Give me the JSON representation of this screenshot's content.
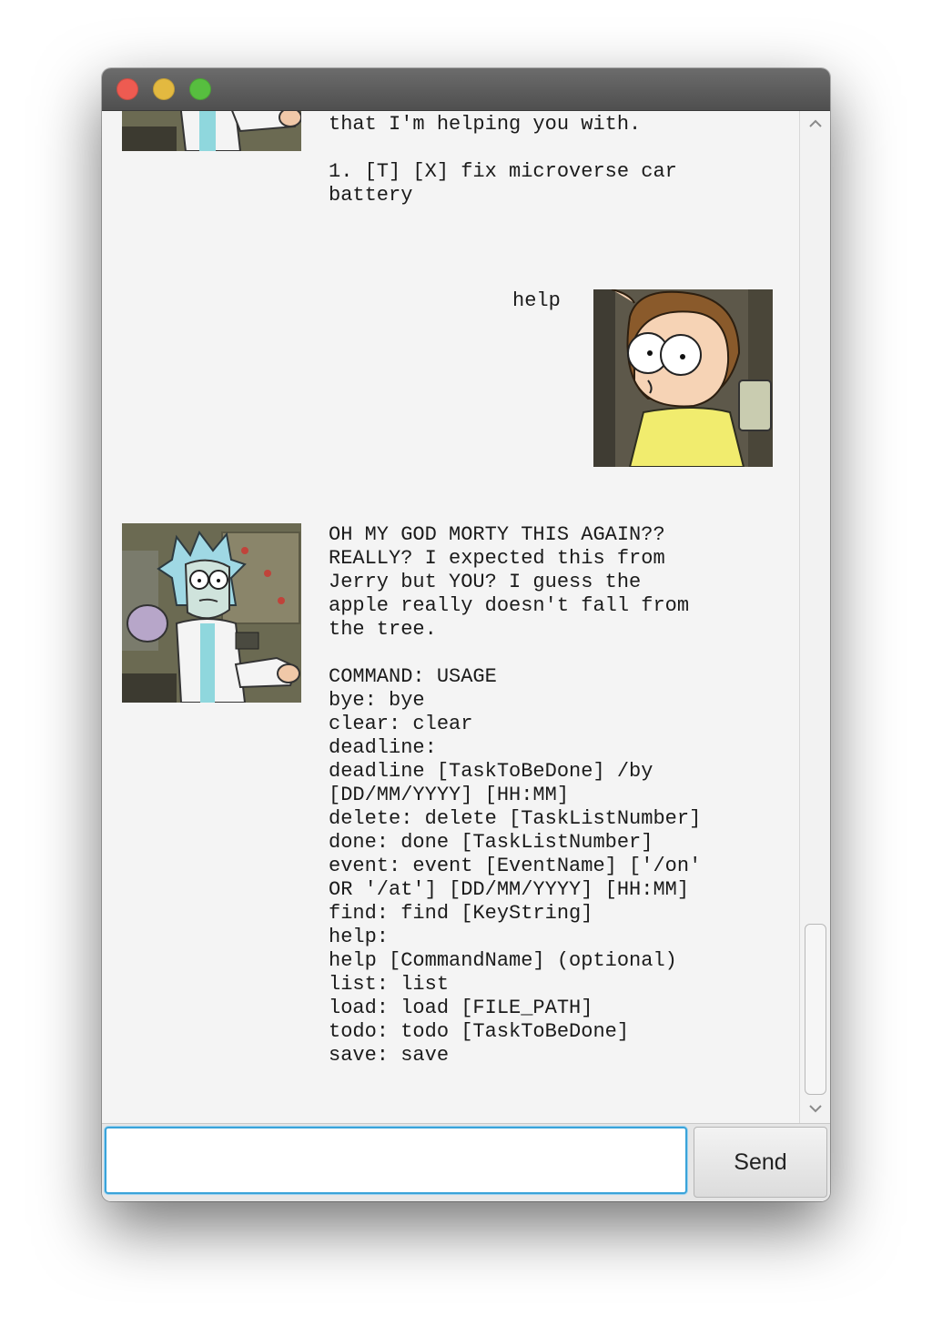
{
  "window": {
    "buttons": [
      "close",
      "minimize",
      "zoom"
    ]
  },
  "messages": [
    {
      "sender": "bot",
      "avatar_icon": "rick-avatar",
      "text": "that I'm helping you with.\n\n1. [T] [X] fix microverse car\nbattery"
    },
    {
      "sender": "user",
      "avatar_icon": "morty-avatar",
      "text": "help"
    },
    {
      "sender": "bot",
      "avatar_icon": "rick-avatar",
      "text": "OH MY GOD MORTY THIS AGAIN??\nREALLY? I expected this from\nJerry but YOU? I guess the\napple really doesn't fall from\nthe tree.\n\nCOMMAND: USAGE\nbye: bye\nclear: clear\ndeadline:\ndeadline [TaskToBeDone] /by\n[DD/MM/YYYY] [HH:MM]\ndelete: delete [TaskListNumber]\ndone: done [TaskListNumber]\nevent: event [EventName] ['/on'\nOR '/at'] [DD/MM/YYYY] [HH:MM]\nfind: find [KeyString]\nhelp:\nhelp [CommandName] (optional)\nlist: list\nload: load [FILE_PATH]\ntodo: todo [TaskToBeDone]\nsave: save"
    }
  ],
  "input": {
    "value": "",
    "placeholder": ""
  },
  "send_button": {
    "label": "Send"
  },
  "scrollbar": {
    "up_icon": "chevron-up-icon",
    "down_icon": "chevron-down-icon"
  }
}
